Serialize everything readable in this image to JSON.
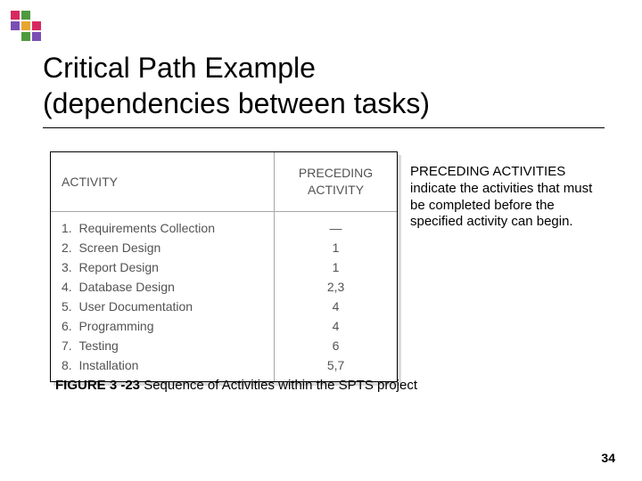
{
  "logo_colors": {
    "a": "#d7295f",
    "b": "#4f9a3f",
    "c": "#7a4fb5",
    "d": "#e6a52f"
  },
  "title": "Critical Path Example\n(dependencies between tasks)",
  "table": {
    "header": {
      "activity": "ACTIVITY",
      "preceding": "PRECEDING\nACTIVITY"
    },
    "rows": [
      {
        "num": "1.",
        "name": "Requirements Collection",
        "preceding": "—"
      },
      {
        "num": "2.",
        "name": "Screen Design",
        "preceding": "1"
      },
      {
        "num": "3.",
        "name": "Report Design",
        "preceding": "1"
      },
      {
        "num": "4.",
        "name": "Database Design",
        "preceding": "2,3"
      },
      {
        "num": "5.",
        "name": "User Documentation",
        "preceding": "4"
      },
      {
        "num": "6.",
        "name": "Programming",
        "preceding": "4"
      },
      {
        "num": "7.",
        "name": "Testing",
        "preceding": "6"
      },
      {
        "num": "8.",
        "name": "Installation",
        "preceding": "5,7"
      }
    ]
  },
  "sidetext": {
    "head": "PRECEDING ACTIVITIES",
    "body": "indicate the activities that must be completed before the specified activity can begin."
  },
  "caption": {
    "label": "FIGURE 3 -23",
    "text": " Sequence of Activities within the SPTS project"
  },
  "pagenum": "34"
}
